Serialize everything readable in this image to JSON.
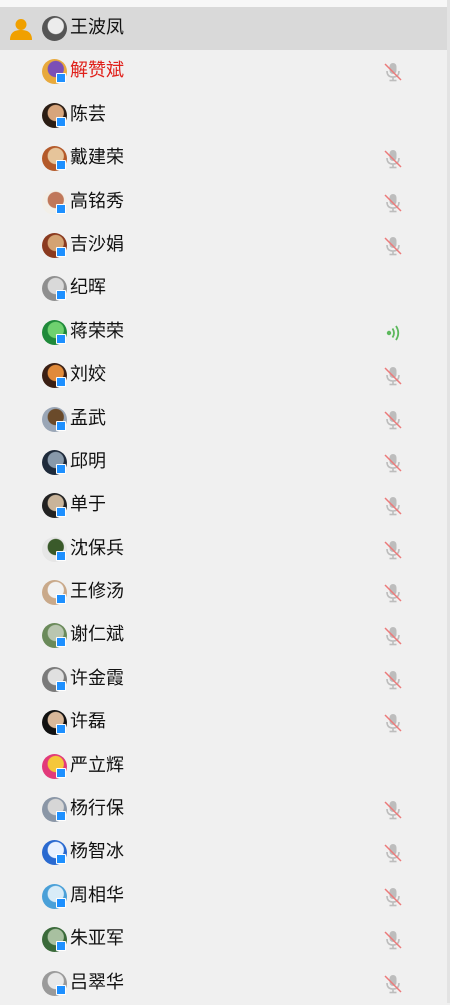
{
  "colors": {
    "background": "#f0f0f0",
    "selected_row": "#d9d9d9",
    "highlight_name": "#e0201a",
    "status_badge": "#1e90ff",
    "mic_muted": "#bdbdbd",
    "mic_slash": "#ec7a7a",
    "mic_speaking": "#5cb85c"
  },
  "members": [
    {
      "name": "王波凤",
      "selected": true,
      "leader": true,
      "badge": false,
      "mic": "none",
      "avatar": [
        "#555555",
        "#ececec"
      ]
    },
    {
      "name": "解赞斌",
      "highlight": true,
      "badge": true,
      "mic": "muted",
      "avatar": [
        "#e8a93c",
        "#7b4fb6"
      ]
    },
    {
      "name": "陈芸",
      "badge": true,
      "mic": "none",
      "avatar": [
        "#2b1d14",
        "#d7a57c"
      ]
    },
    {
      "name": "戴建荣",
      "badge": true,
      "mic": "muted",
      "avatar": [
        "#b45a2a",
        "#e6c49a"
      ]
    },
    {
      "name": "高铭秀",
      "badge": true,
      "mic": "muted",
      "avatar": [
        "#f2efe8",
        "#c0785a"
      ]
    },
    {
      "name": "吉沙娟",
      "badge": true,
      "mic": "muted",
      "avatar": [
        "#8a3a1f",
        "#d4a373"
      ]
    },
    {
      "name": "纪晖",
      "badge": true,
      "mic": "none",
      "avatar": [
        "#8f8f8f",
        "#d9d9d9"
      ]
    },
    {
      "name": "蒋荣荣",
      "badge": true,
      "mic": "speaking",
      "avatar": [
        "#1f8a3a",
        "#6fd16f"
      ]
    },
    {
      "name": "刘姣",
      "badge": true,
      "mic": "muted",
      "avatar": [
        "#3a1f14",
        "#e08a3a"
      ]
    },
    {
      "name": "孟武",
      "badge": true,
      "mic": "muted",
      "avatar": [
        "#9aa6b6",
        "#6a4a2a"
      ]
    },
    {
      "name": "邱明",
      "badge": true,
      "mic": "muted",
      "avatar": [
        "#1e2a3a",
        "#8899aa"
      ]
    },
    {
      "name": "单于",
      "badge": true,
      "mic": "muted",
      "avatar": [
        "#222222",
        "#c9b49a"
      ]
    },
    {
      "name": "沈保兵",
      "badge": true,
      "mic": "muted",
      "avatar": [
        "#e6e6e6",
        "#3a5a2a"
      ]
    },
    {
      "name": "王修汤",
      "badge": true,
      "mic": "muted",
      "avatar": [
        "#c9a98a",
        "#f2f2f2"
      ]
    },
    {
      "name": "谢仁斌",
      "badge": true,
      "mic": "muted",
      "avatar": [
        "#6a8a5a",
        "#b9c6b0"
      ]
    },
    {
      "name": "许金霞",
      "badge": true,
      "mic": "muted",
      "avatar": [
        "#7a7a7a",
        "#e0e0e0"
      ]
    },
    {
      "name": "许磊",
      "badge": true,
      "mic": "muted",
      "avatar": [
        "#111111",
        "#d8b89a"
      ]
    },
    {
      "name": "严立辉",
      "badge": true,
      "mic": "none",
      "avatar": [
        "#e23a7a",
        "#f5c73a"
      ]
    },
    {
      "name": "杨行保",
      "badge": true,
      "mic": "muted",
      "avatar": [
        "#8a96a6",
        "#d6d6d6"
      ]
    },
    {
      "name": "杨智冰",
      "badge": true,
      "mic": "muted",
      "avatar": [
        "#2a6ad0",
        "#e9f2ff"
      ]
    },
    {
      "name": "周相华",
      "badge": true,
      "mic": "muted",
      "avatar": [
        "#4aa0d8",
        "#d8ecf8"
      ]
    },
    {
      "name": "朱亚军",
      "badge": true,
      "mic": "muted",
      "avatar": [
        "#3a6a3a",
        "#a8c0a0"
      ]
    },
    {
      "name": "吕翠华",
      "badge": true,
      "mic": "muted",
      "avatar": [
        "#9a9a9a",
        "#e8e8e8"
      ]
    }
  ]
}
